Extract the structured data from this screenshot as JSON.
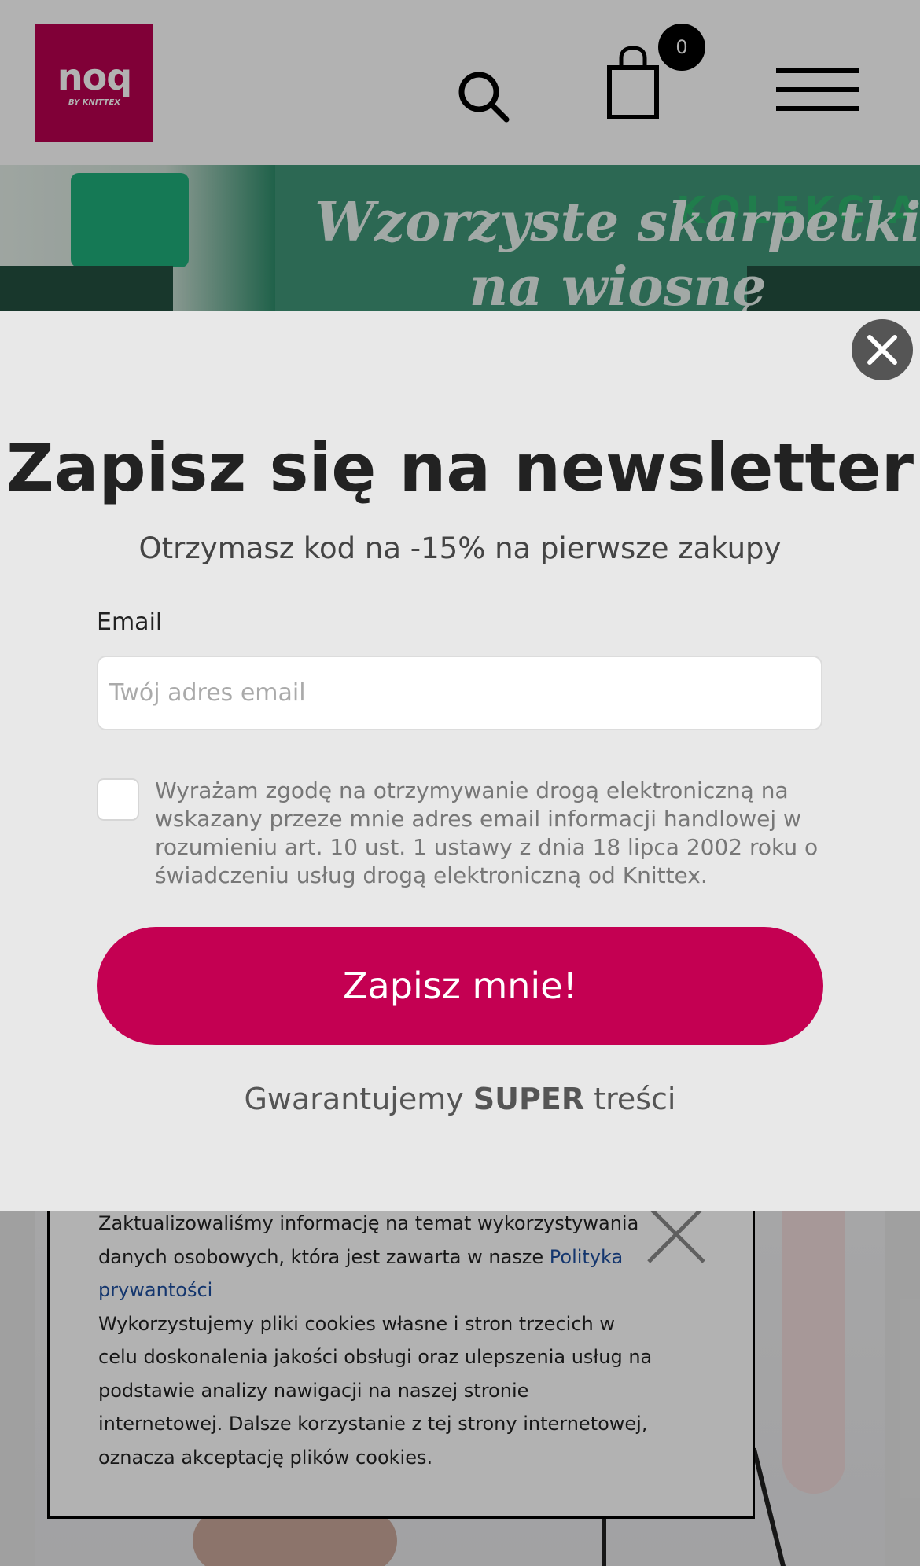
{
  "header": {
    "logo_text": "noq",
    "logo_subtext": "BY KNITTEX",
    "cart_count": "0",
    "brand_color": "#b8004f"
  },
  "banner": {
    "title_line1": "Wzorzyste skarpetki",
    "title_line2": "na wiosnę",
    "corner_text": "KOLEKCJA"
  },
  "cookie_notice": {
    "text_1": "Zaktualizowaliśmy informację na temat wykorzystywania danych osobowych, która jest zawarta w nasze ",
    "policy_link": "Polityka prywantości",
    "text_2": "Wykorzystujemy pliki cookies własne i stron trzecich w celu doskonalenia jakości obsługi oraz ulepszenia usług na podstawie analizy nawigacji na naszej stronie internetowej. Dalsze korzystanie z tej strony internetowej, oznacza akceptację plików cookies."
  },
  "newsletter": {
    "title": "Zapisz się na newsletter",
    "subtitle": "Otrzymasz kod na -15% na pierwsze zakupy",
    "email_label": "Email",
    "email_placeholder": "Twój adres email",
    "email_value": "",
    "consent_text": "Wyrażam zgodę na otrzymywanie drogą elektroniczną na wskazany przeze mnie adres email informacji handlowej w rozumieniu art. 10 ust. 1 ustawy z dnia 18 lipca 2002 roku o świadczeniu usług drogą elektroniczną od Knittex.",
    "consent_checked": false,
    "submit_label": "Zapisz mnie!",
    "guarantee_prefix": "Gwarantujemy ",
    "guarantee_bold": "SUPER",
    "guarantee_suffix": " treści",
    "button_color": "#c40052"
  }
}
